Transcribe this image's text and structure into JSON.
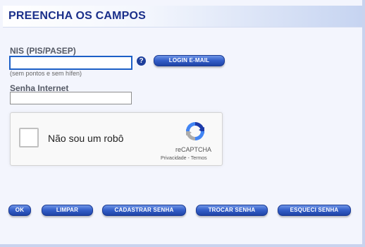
{
  "header": {
    "title": "PREENCHA OS CAMPOS"
  },
  "form": {
    "nis_label": "NIS (PIS/PASEP)",
    "nis_value": "",
    "nis_hint": "(sem pontos e sem hífen)",
    "help_glyph": "?",
    "login_email_label": "LOGIN E-MAIL",
    "password_label": "Senha Internet",
    "password_value": ""
  },
  "captcha": {
    "checkbox_label": "Não sou um robô",
    "brand": "reCAPTCHA",
    "privacy": "Privacidade",
    "separator": " - ",
    "terms": "Termos"
  },
  "actions": {
    "ok": "OK",
    "clear": "LIMPAR",
    "register_password": "CADASTRAR SENHA",
    "change_password": "TROCAR SENHA",
    "forgot_password": "ESQUECI SENHA"
  },
  "colors": {
    "title": "#1a2f8a",
    "button": "#3661cb",
    "panel_bg": "#f3f5fd",
    "focus_border": "#1c5fc7"
  },
  "icons": {
    "help": "question-circle-icon",
    "captcha_logo": "recaptcha-logo-icon"
  }
}
